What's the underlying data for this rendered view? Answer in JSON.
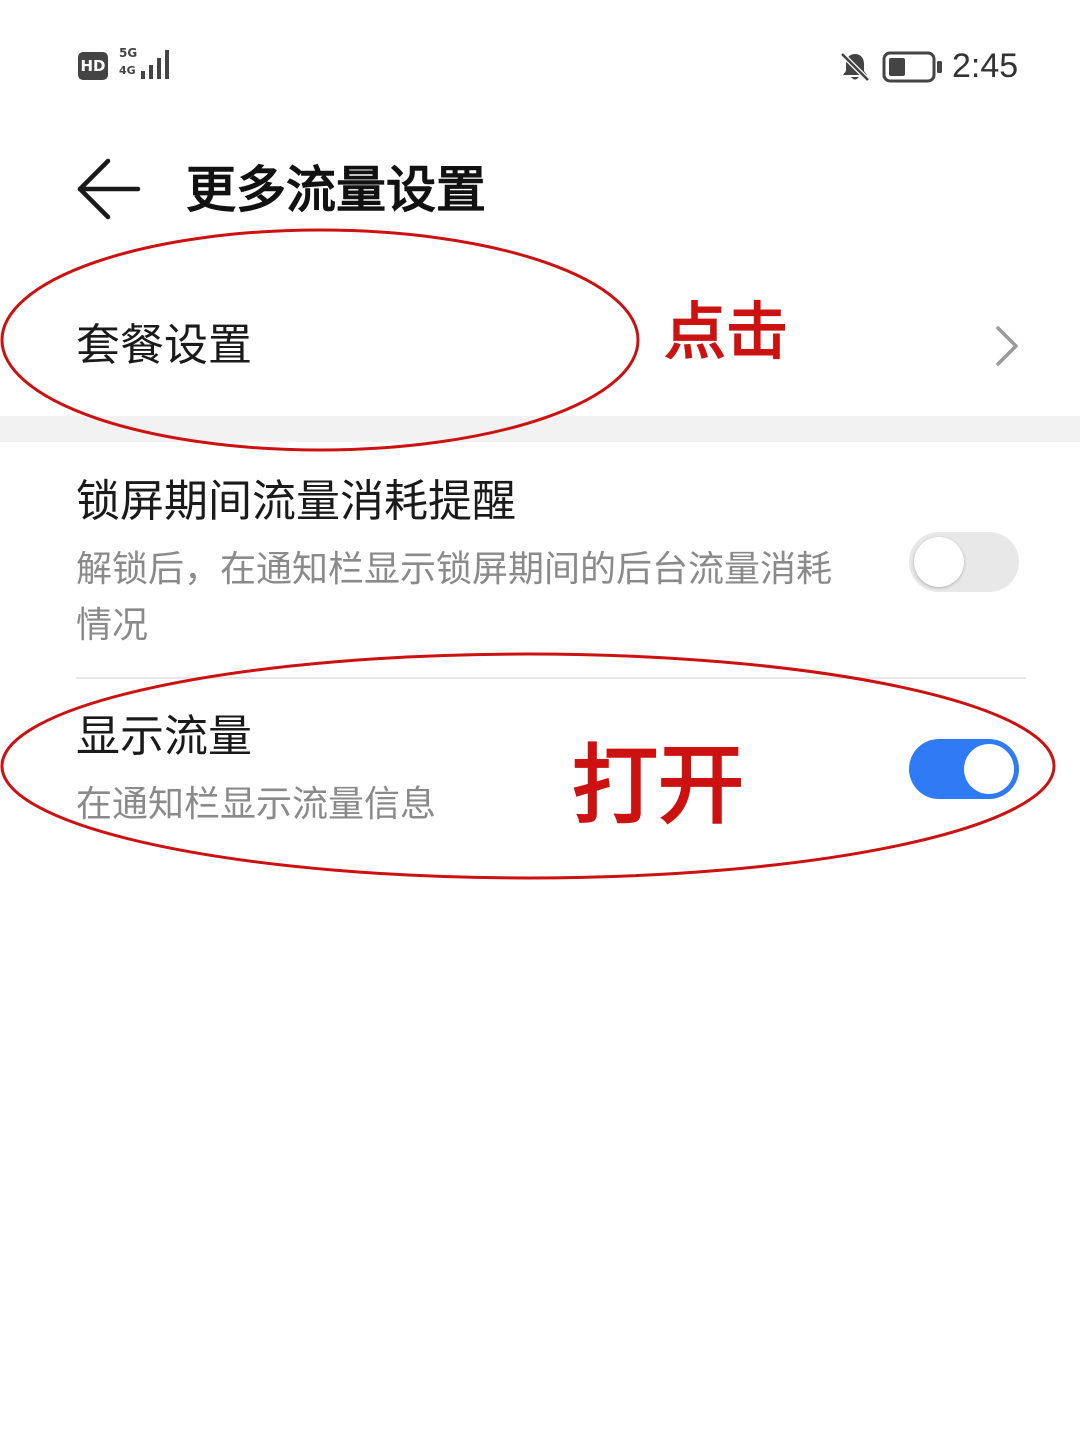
{
  "status_bar": {
    "hd_badge": "HD",
    "network_5g": "5G",
    "network_4g": "4G",
    "time": "2:45",
    "icons": [
      "hd-icon",
      "signal-icon",
      "bell-off-icon",
      "battery-icon"
    ]
  },
  "header": {
    "title": "更多流量设置",
    "back_icon": "back-arrow-icon"
  },
  "plan_settings": {
    "label": "套餐设置",
    "chevron_icon": "chevron-right-icon"
  },
  "lock_screen_reminder": {
    "title": "锁屏期间流量消耗提醒",
    "subtitle": "解锁后，在通知栏显示锁屏期间的后台流量消耗情况",
    "enabled": false
  },
  "show_traffic": {
    "title": "显示流量",
    "subtitle": "在通知栏显示流量信息",
    "enabled": true
  },
  "annotations": {
    "click_label": "点击",
    "open_label": "打开",
    "color": "#cc1111"
  },
  "colors": {
    "toggle_on": "#2f7bf5",
    "toggle_off": "#e8e8e8",
    "section_gap": "#f2f2f2"
  }
}
